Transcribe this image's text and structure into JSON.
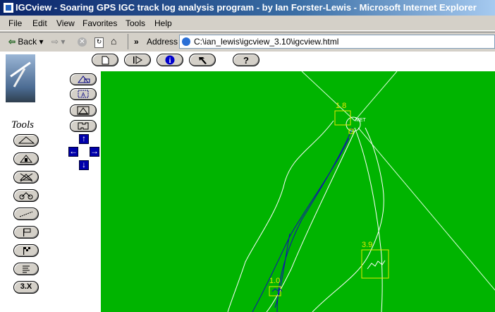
{
  "window": {
    "title": "IGCview - Soaring GPS IGC track log analysis program - by Ian Forster-Lewis - Microsoft Internet Explorer"
  },
  "menu": [
    "File",
    "Edit",
    "View",
    "Favorites",
    "Tools",
    "Help"
  ],
  "toolbar": {
    "back_label": "Back",
    "chevron": "»",
    "address_label": "Address",
    "address_value": "C:\\ian_lewis\\igcview_3.10\\igcview.html"
  },
  "tools": {
    "title": "Tools",
    "version_label": "3.X"
  },
  "map": {
    "bg_color": "#00b400",
    "labels": [
      "1.8",
      "3.9",
      "1.0",
      "MET"
    ]
  },
  "icons": {
    "top_buttons": [
      "new-page-icon",
      "play-step-icon",
      "info-icon",
      "hammer-icon",
      "help-icon"
    ],
    "tool_buttons": [
      "triangle-icon",
      "alert-house-icon",
      "crossed-icon",
      "bike-icon",
      "ruler-icon",
      "flag-icon",
      "checkered-flag-icon",
      "list-icon"
    ],
    "view_buttons": [
      "house-zoom-icon",
      "zoom-box-icon",
      "triangle-view-icon",
      "puzzle-icon"
    ],
    "arrows": [
      "up-arrow-icon",
      "left-arrow-icon",
      "right-arrow-icon",
      "down-arrow-icon"
    ]
  }
}
